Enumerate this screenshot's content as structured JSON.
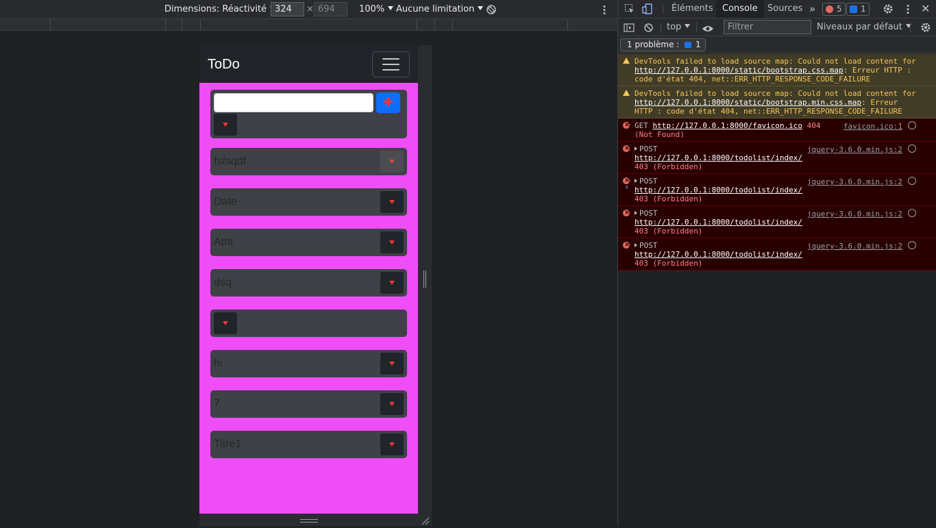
{
  "device_toolbar": {
    "dimensions_label": "Dimensions: Réactivité",
    "width_value": "324",
    "height_value": "694",
    "zoom": "100%",
    "throttle": "Aucune limitation"
  },
  "app": {
    "brand": "ToDo",
    "new_item_placeholder": "",
    "add_button": "✚",
    "items": [
      {
        "text": "fsfsqdf"
      },
      {
        "text": "Date"
      },
      {
        "text": "Atttr"
      },
      {
        "text": "dsq"
      },
      {
        "text": ""
      },
      {
        "text": "hi"
      },
      {
        "text": "7"
      },
      {
        "text": "Titre1"
      }
    ]
  },
  "devtools": {
    "tabs": [
      "Éléments",
      "Console",
      "Sources"
    ],
    "active_tab": "Console",
    "error_count": "5",
    "message_count": "1",
    "context": "top",
    "filter_placeholder": "Filtrer",
    "levels": "Niveaux par défaut",
    "issues_label": "1 problème :",
    "issues_count": "1",
    "messages": [
      {
        "type": "warn",
        "prefix": "DevTools failed to load source map: Could not load content for ",
        "url": "http://127.0.0.1:8000/static/bootstrap.css.map",
        "suffix": ": Erreur HTTP : code d'état 404, net::ERR_HTTP_RESPONSE_CODE_FAILURE"
      },
      {
        "type": "warn",
        "prefix": "DevTools failed to load source map: Could not load content for ",
        "url": "http://127.0.0.1:8000/static/bootstrap.min.css.map",
        "suffix": ": Erreur HTTP : code d'état 404, net::ERR_HTTP_RESPONSE_CODE_FAILURE"
      },
      {
        "type": "err",
        "method": "GET",
        "url": "http://127.0.0.1:8000/favicon.ico",
        "suffix": " 404 (Not Found)",
        "source": "favicon.ico:1"
      },
      {
        "type": "err",
        "method": "POST",
        "url": "http://127.0.0.1:8000/todolist/index/",
        "suffix": " 403 (Forbidden)",
        "source": "jquery-3.6.0.min.js:2"
      },
      {
        "type": "err",
        "method": "POST",
        "url": "http://127.0.0.1:8000/todolist/index/",
        "suffix": " 403 (Forbidden)",
        "source": "jquery-3.6.0.min.js:2"
      },
      {
        "type": "err",
        "method": "POST",
        "url": "http://127.0.0.1:8000/todolist/index/",
        "suffix": " 403 (Forbidden)",
        "source": "jquery-3.6.0.min.js:2"
      },
      {
        "type": "err",
        "method": "POST",
        "url": "http://127.0.0.1:8000/todolist/index/",
        "suffix": " 403 (Forbidden)",
        "source": "jquery-3.6.0.min.js:2"
      }
    ]
  },
  "colors": {
    "page_background": "#ee4df7",
    "navbar": "#212529",
    "card": "#3f4147",
    "accent_blue": "#0d6efd",
    "caret_red": "#e9373a"
  }
}
